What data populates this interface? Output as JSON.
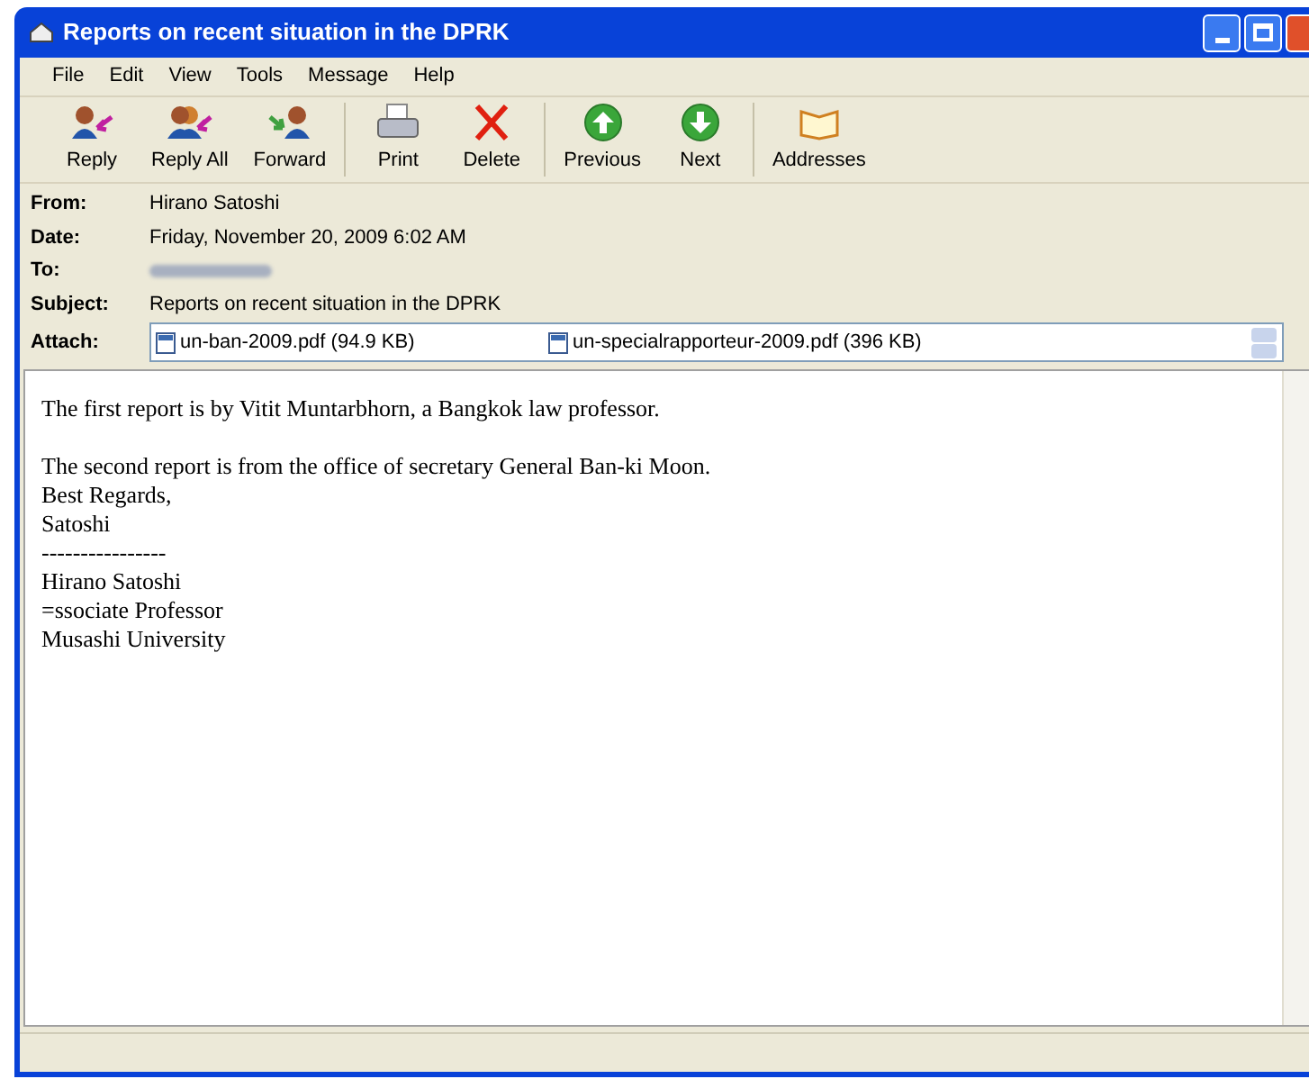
{
  "window": {
    "title": "Reports on recent situation in the DPRK"
  },
  "menu": [
    "File",
    "Edit",
    "View",
    "Tools",
    "Message",
    "Help"
  ],
  "toolbar": [
    {
      "kind": "reply",
      "label": "Reply"
    },
    {
      "kind": "reply_all",
      "label": "Reply All"
    },
    {
      "kind": "forward",
      "label": "Forward"
    },
    {
      "kind": "separator"
    },
    {
      "kind": "print",
      "label": "Print"
    },
    {
      "kind": "delete",
      "label": "Delete"
    },
    {
      "kind": "separator"
    },
    {
      "kind": "previous",
      "label": "Previous"
    },
    {
      "kind": "next",
      "label": "Next"
    },
    {
      "kind": "separator"
    },
    {
      "kind": "addresses",
      "label": "Addresses"
    }
  ],
  "header": {
    "from_label": "From:",
    "from": "Hirano Satoshi",
    "date_label": "Date:",
    "date": "Friday, November 20, 2009 6:02 AM",
    "to_label": "To:",
    "subject_label": "Subject:",
    "subject": "Reports on recent situation in the DPRK",
    "attach_label": "Attach:",
    "attachments": [
      "un-ban-2009.pdf (94.9 KB)",
      "un-specialrapporteur-2009.pdf (396 KB)"
    ]
  },
  "body": [
    [
      "The first report is by Vitit Muntarbhorn, a Bangkok law professor."
    ],
    [
      "The second report is from the office of secretary General Ban-ki Moon.",
      "Best Regards,",
      "Satoshi",
      "----------------",
      "Hirano Satoshi",
      "=ssociate Professor",
      "Musashi University"
    ]
  ]
}
